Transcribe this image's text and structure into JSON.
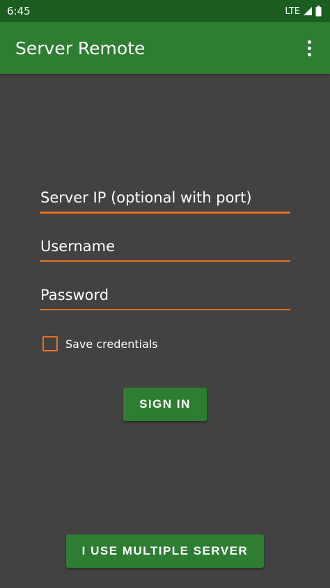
{
  "status_bar": {
    "time": "6:45",
    "network": "LTE"
  },
  "app_bar": {
    "title": "Server Remote",
    "menu_icon": "overflow-vertical-icon"
  },
  "form": {
    "server_ip": {
      "value": "",
      "placeholder": "Server IP (optional with port)"
    },
    "username": {
      "value": "",
      "placeholder": "Username"
    },
    "password": {
      "value": "",
      "placeholder": "Password"
    },
    "save_credentials": {
      "label": "Save credentials",
      "checked": false
    }
  },
  "buttons": {
    "sign_in": "SIGN IN",
    "multiple_server": "I USE MULTIPLE SERVER"
  },
  "colors": {
    "background": "#424242",
    "app_bar": "#2e7d32",
    "status_bar": "#1b5e20",
    "accent": "#e8721f",
    "button": "#2e7d32"
  }
}
